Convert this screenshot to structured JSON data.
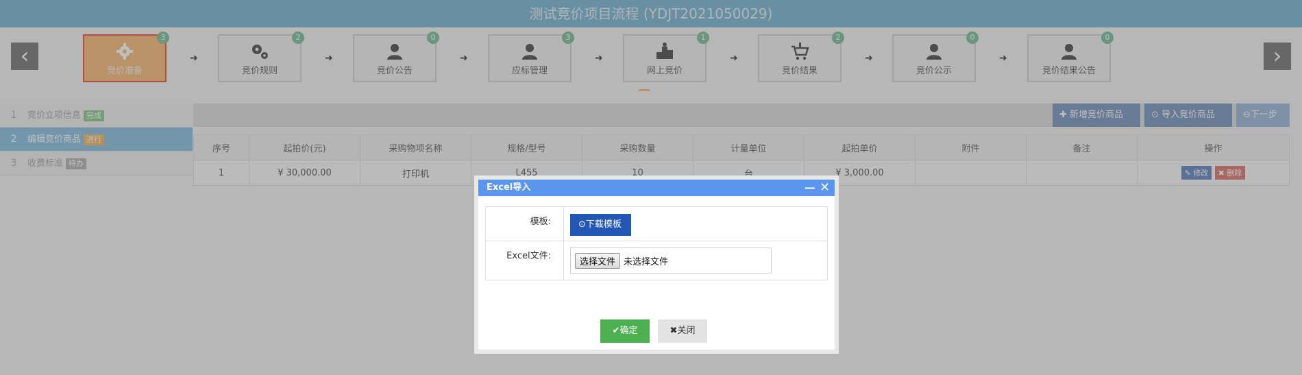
{
  "header": {
    "title": "测试竞价项目流程 (YDJT2021050029)"
  },
  "flow": {
    "prev_label": "‹",
    "next_label": "›",
    "steps": [
      {
        "label": "竞价准备",
        "badge": "3"
      },
      {
        "label": "竞价规则",
        "badge": "2"
      },
      {
        "label": "竞价公告",
        "badge": "0"
      },
      {
        "label": "应标管理",
        "badge": "3"
      },
      {
        "label": "网上竞价",
        "badge": "1"
      },
      {
        "label": "竞价结果",
        "badge": "2"
      },
      {
        "label": "竞价公示",
        "badge": "0"
      },
      {
        "label": "竞价结果公告",
        "badge": "0"
      }
    ]
  },
  "left_nav": {
    "items": [
      {
        "num": "1",
        "label": "竞价立项信息",
        "tag": "完成",
        "tag_color": "#9bd29b"
      },
      {
        "num": "2",
        "label": "编辑竞价商品",
        "tag": "进行",
        "tag_color": "#f0c27a"
      },
      {
        "num": "3",
        "label": "收费标准",
        "tag": "待办",
        "tag_color": "#bdbdbd"
      }
    ]
  },
  "toolbar": {
    "add_label": "新增竞价商品",
    "import_label": "导入竞价商品",
    "next_label": "下一步"
  },
  "table": {
    "headers": [
      "序号",
      "起拍价(元)",
      "采购物项名称",
      "规格/型号",
      "采购数量",
      "计量单位",
      "起拍单价",
      "附件",
      "备注",
      "操作"
    ],
    "row": [
      "1",
      "¥ 30,000.00",
      "打印机",
      "L455",
      "10",
      "台",
      "¥ 3,000.00",
      "",
      ""
    ],
    "edit_label": "修改",
    "delete_label": "删除"
  },
  "dialog": {
    "title": "Excel导入",
    "template_label": "模板:",
    "download_label": "下载模板",
    "file_label": "Excel文件:",
    "choose_label": "选择文件",
    "no_file_label": "未选择文件",
    "ok_label": "确定",
    "close_label": "关闭"
  }
}
